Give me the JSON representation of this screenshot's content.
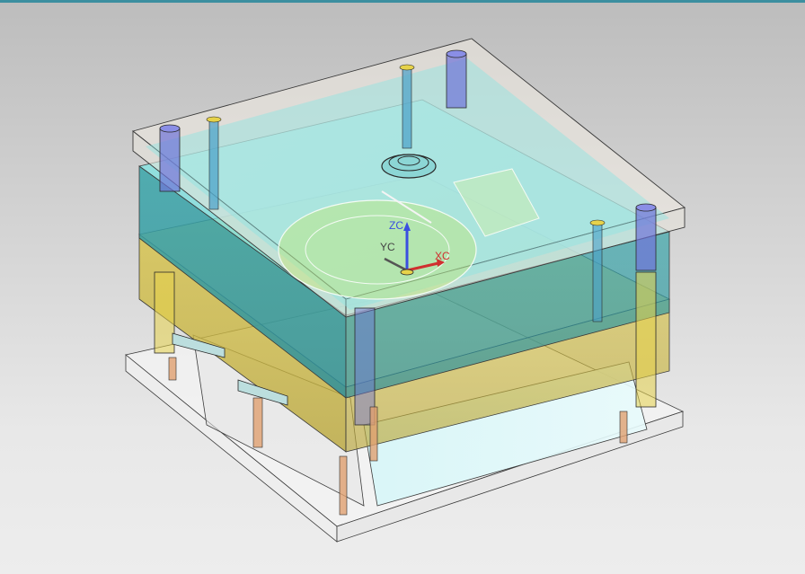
{
  "viewport": {
    "background_top": "#bdbdbd",
    "background_bottom": "#ededed",
    "frame_accent": "#3c8fa0"
  },
  "model": {
    "subject": "mold-assembly",
    "colors": {
      "cavity_plate": "#7fe0e0",
      "core_plate": "#e6d24a",
      "clamp_plate": "#f2f2f2",
      "pillar_blue": "#6f74d8",
      "pin_orange": "#e0a070",
      "edge": "#3a3a3a"
    }
  },
  "triad": {
    "z_label": "ZC",
    "y_label": "YC",
    "x_label": "XC",
    "z_color": "#3a4fe0",
    "y_color": "#555555",
    "x_color": "#d03030"
  }
}
